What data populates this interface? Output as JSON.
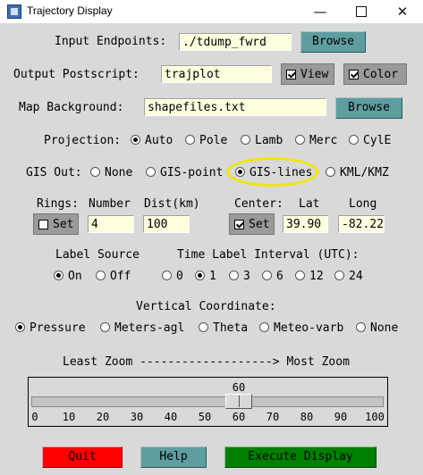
{
  "window": {
    "title": "Trajectory Display",
    "minimize_icon": "minimize-icon",
    "maximize_icon": "maximize-icon",
    "close_icon": "close-icon"
  },
  "input_endpoints": {
    "label": "Input Endpoints:",
    "value": "./tdump_fwrd",
    "browse_label": "Browse"
  },
  "output_postscript": {
    "label": "Output Postscript:",
    "value": "trajplot",
    "view_label": "View",
    "view_checked": true,
    "color_label": "Color",
    "color_checked": true
  },
  "map_background": {
    "label": "Map Background:",
    "value": "shapefiles.txt",
    "browse_label": "Browse"
  },
  "projection": {
    "label": "Projection:",
    "options": [
      "Auto",
      "Pole",
      "Lamb",
      "Merc",
      "CylE"
    ],
    "selected": "Auto"
  },
  "gis_out": {
    "label": "GIS Out:",
    "options": [
      "None",
      "GIS-point",
      "GIS-lines",
      "KML/KMZ"
    ],
    "selected": "GIS-lines"
  },
  "rings": {
    "label": "Rings:",
    "number_label": "Number",
    "dist_label": "Dist(km)",
    "set_label": "Set",
    "set_checked": false,
    "number_value": "4",
    "dist_value": "100"
  },
  "center": {
    "label": "Center:",
    "lat_label": "Lat",
    "long_label": "Long",
    "set_label": "Set",
    "set_checked": true,
    "lat_value": "39.90",
    "long_value": "-82.22"
  },
  "label_source": {
    "label": "Label Source",
    "options": [
      "On",
      "Off"
    ],
    "selected": "On"
  },
  "time_label_interval": {
    "label": "Time Label Interval (UTC):",
    "options": [
      "0",
      "1",
      "3",
      "6",
      "12",
      "24"
    ],
    "selected": "1"
  },
  "vertical_coordinate": {
    "label": "Vertical Coordinate:",
    "options": [
      "Pressure",
      "Meters-agl",
      "Theta",
      "Meteo-varb",
      "None"
    ],
    "selected": "Pressure"
  },
  "zoom": {
    "caption": "Least Zoom -------------------> Most Zoom",
    "value": 60,
    "value_label": "60",
    "min": 0,
    "max": 100,
    "ticks": [
      "0",
      "10",
      "20",
      "30",
      "40",
      "50",
      "60",
      "70",
      "80",
      "90",
      "100"
    ]
  },
  "buttons": {
    "quit": "Quit",
    "help": "Help",
    "execute": "Execute Display",
    "colors": {
      "quit": "#ff0000",
      "help": "#5f9ea0",
      "execute": "#008000",
      "browse": "#5f9ea0",
      "checkbutton": "#9a9a9a"
    }
  },
  "colors": {
    "background": "#d9d9d9",
    "entry": "#ffffe0",
    "highlight_ring": "#f2e600"
  }
}
